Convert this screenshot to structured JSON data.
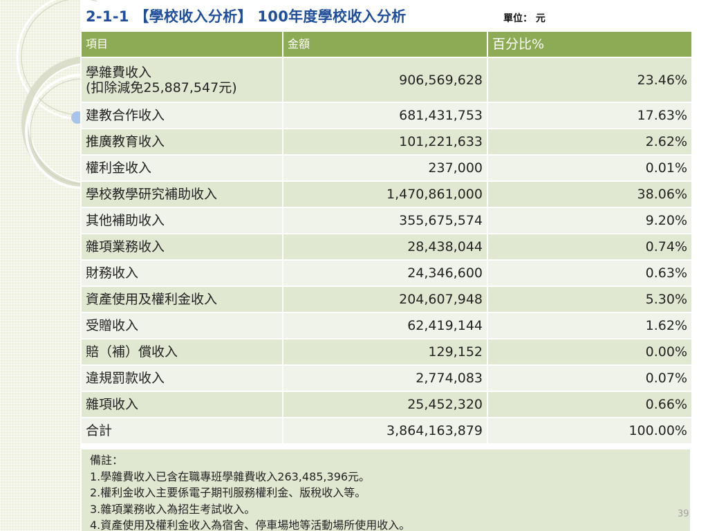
{
  "slide": {
    "title": "2-1-1 【學校收入分析】 100年度學校收入分析",
    "unit": "單位： 元",
    "page_number": "39"
  },
  "table": {
    "headers": [
      "項目",
      "金額",
      "百分比%"
    ],
    "rows": [
      {
        "item": "學雜費收入",
        "item_sub": "(扣除減免25,887,547元)",
        "amount": "906,569,628",
        "percent": "23.46%"
      },
      {
        "item": "建教合作收入",
        "amount": "681,431,753",
        "percent": "17.63%"
      },
      {
        "item": "推廣教育收入",
        "amount": "101,221,633",
        "percent": "2.62%"
      },
      {
        "item": "權利金收入",
        "amount": "237,000",
        "percent": "0.01%"
      },
      {
        "item": "學校教學研究補助收入",
        "amount": "1,470,861,000",
        "percent": "38.06%"
      },
      {
        "item": "其他補助收入",
        "amount": "355,675,574",
        "percent": "9.20%"
      },
      {
        "item": "雜項業務收入",
        "amount": "28,438,044",
        "percent": "0.74%"
      },
      {
        "item": "財務收入",
        "amount": "24,346,600",
        "percent": "0.63%"
      },
      {
        "item": "資產使用及權利金收入",
        "amount": "204,607,948",
        "percent": "5.30%"
      },
      {
        "item": "受贈收入",
        "amount": "62,419,144",
        "percent": "1.62%"
      },
      {
        "item": "賠（補）償收入",
        "amount": "129,152",
        "percent": "0.00%"
      },
      {
        "item": "違規罰款收入",
        "amount": "2,774,083",
        "percent": "0.07%"
      },
      {
        "item": "雜項收入",
        "amount": "25,452,320",
        "percent": "0.66%"
      },
      {
        "item": "合計",
        "amount": "3,864,163,879",
        "percent": "100.00%"
      }
    ]
  },
  "notes": {
    "heading": "備註：",
    "lines": [
      "1.學雜費收入已含在職專班學雜費收入263,485,396元。",
      "2.權利金收入主要係電子期刊服務權利金、版稅收入等。",
      "3.雜項業務收入為招生考試收入。",
      "4.資產使用及權利金收入為宿舍、停車場地等活動場所使用收入。"
    ]
  },
  "colors": {
    "title": "#1f4e9a",
    "header_bg": "#8dab55",
    "row_odd": "#e1e8d2",
    "row_even": "#f0f3e9",
    "accent_dot": "#a9c4ea"
  }
}
